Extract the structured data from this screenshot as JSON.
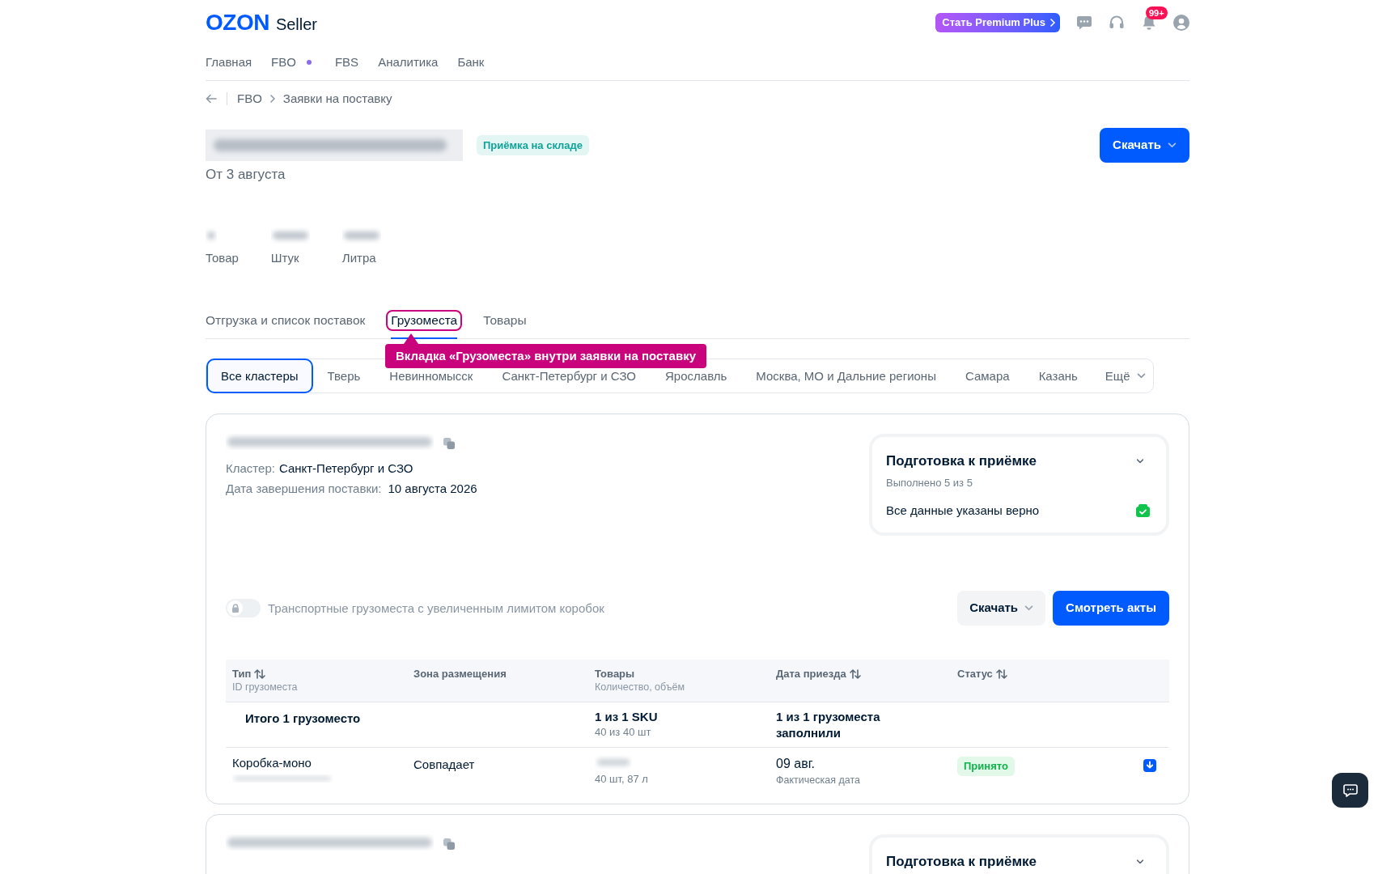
{
  "header": {
    "logo": "OZON",
    "logo_label": "Seller",
    "premium_button": "Стать Premium Plus",
    "notification_badge": "99+"
  },
  "nav": [
    {
      "label": "Главная",
      "dot": false
    },
    {
      "label": "FBO",
      "dot": true
    },
    {
      "label": "FBS",
      "dot": false
    },
    {
      "label": "Аналитика",
      "dot": false
    },
    {
      "label": "Банк",
      "dot": false
    }
  ],
  "breadcrumb": [
    "FBO",
    "Заявки на поставку"
  ],
  "request": {
    "status_badge": "Приёмка на складе",
    "date": "От 3 августа",
    "download_button": "Скачать"
  },
  "stats": [
    {
      "label": "Товар"
    },
    {
      "label": "Штук"
    },
    {
      "label": "Литра"
    }
  ],
  "tabs": [
    {
      "label": "Отгрузка и список поставок",
      "selected": false,
      "highlighted": false
    },
    {
      "label": "Грузоместа",
      "selected": true,
      "highlighted": true
    },
    {
      "label": "Товары",
      "selected": false,
      "highlighted": false
    }
  ],
  "callout": "Вкладка «Грузоместа» внутри заявки на поставку",
  "clusters": [
    {
      "label": "Все кластеры",
      "selected": true
    },
    {
      "label": "Тверь",
      "selected": false
    },
    {
      "label": "Невинномысск",
      "selected": false
    },
    {
      "label": "Санкт-Петербург и СЗО",
      "selected": false
    },
    {
      "label": "Ярославль",
      "selected": false
    },
    {
      "label": "Москва, МО и Дальние регионы",
      "selected": false
    },
    {
      "label": "Самара",
      "selected": false
    },
    {
      "label": "Казань",
      "selected": false
    }
  ],
  "clusters_more": "Ещё",
  "supplies": [
    {
      "cluster_label": "Кластер:",
      "cluster": "Санкт-Петербург и СЗО",
      "end_date_label": "Дата завершения поставки:",
      "end_date": "10 августа 2026",
      "checklist": {
        "title": "Подготовка к приёмке",
        "completed": "Выполнено 5 из 5",
        "items": [
          {
            "label": "Все данные указаны верно",
            "done": true
          }
        ]
      },
      "toggle": {
        "label": "Транспортные грузоместа с увеличенным лимитом коробок",
        "on": false,
        "locked": true
      },
      "actions": [
        {
          "label": "Скачать",
          "kind": "dropdown"
        },
        {
          "label": "Смотреть акты",
          "kind": "primary"
        }
      ],
      "table": {
        "columns": [
          {
            "title": "Тип",
            "subtitle": "ID грузоместа",
            "sortable": true
          },
          {
            "title": "Зона размещения",
            "sortable": false
          },
          {
            "title": "Товары",
            "subtitle": "Количество, объём",
            "sortable": false
          },
          {
            "title": "Дата приезда",
            "sortable": true
          },
          {
            "title": "Статус",
            "sortable": true
          }
        ],
        "summary": {
          "label": "Итого 1 грузоместо",
          "goods": "1 из 1 SKU",
          "goods_detail": "40 из 40 шт",
          "arrival": "1 из 1 грузоместа заполнили"
        },
        "rows": [
          {
            "type": "Коробка-моно",
            "zone": "Совпадает",
            "goods_detail": "40 шт, 87 л",
            "arrival": "09 авг.",
            "arrival_note": "Фактическая дата",
            "status": "Принято"
          }
        ]
      }
    },
    {
      "checklist": {
        "title": "Подготовка к приёмке"
      }
    }
  ]
}
